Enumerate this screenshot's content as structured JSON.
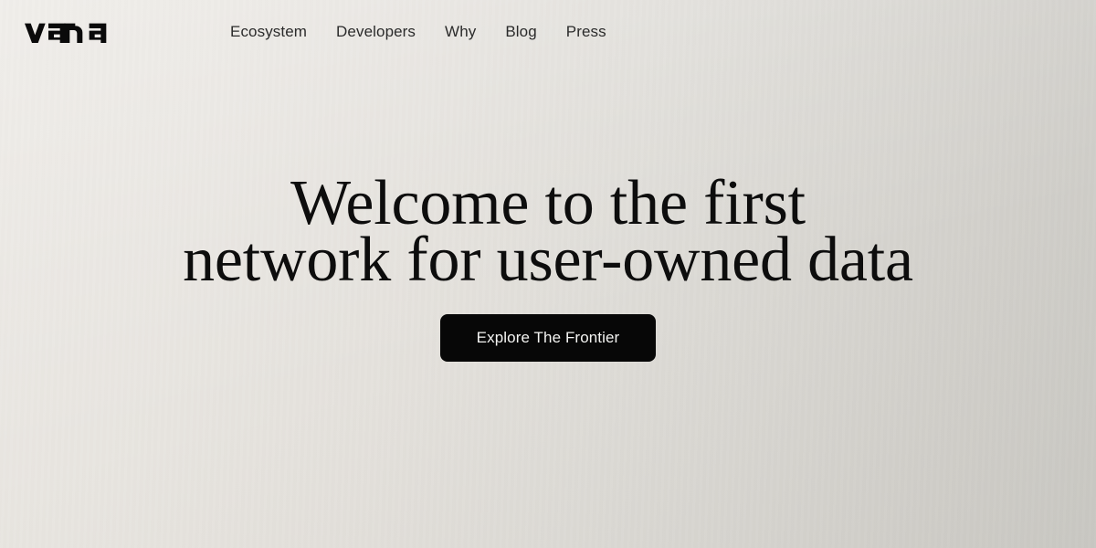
{
  "header": {
    "logo": {
      "text": "vana",
      "icon": "vana-wordmark-logo",
      "color": "#0A0A0A"
    },
    "nav": [
      {
        "label": "Ecosystem"
      },
      {
        "label": "Developers"
      },
      {
        "label": "Why"
      },
      {
        "label": "Blog"
      },
      {
        "label": "Press"
      }
    ]
  },
  "hero": {
    "headline": "Welcome to the first\nnetwork for user-owned data",
    "headline_line_1": "Welcome to the first",
    "headline_line_2": "network for user-owned data",
    "cta_label": "Explore The Frontier"
  },
  "theme": {
    "background_left": "#EAE7E2",
    "background_right": "#CCCBC6",
    "text_primary": "#0D0D0D",
    "nav_text": "#2B2B2B",
    "button_background": "#070707",
    "button_text": "#F4F4F2"
  }
}
